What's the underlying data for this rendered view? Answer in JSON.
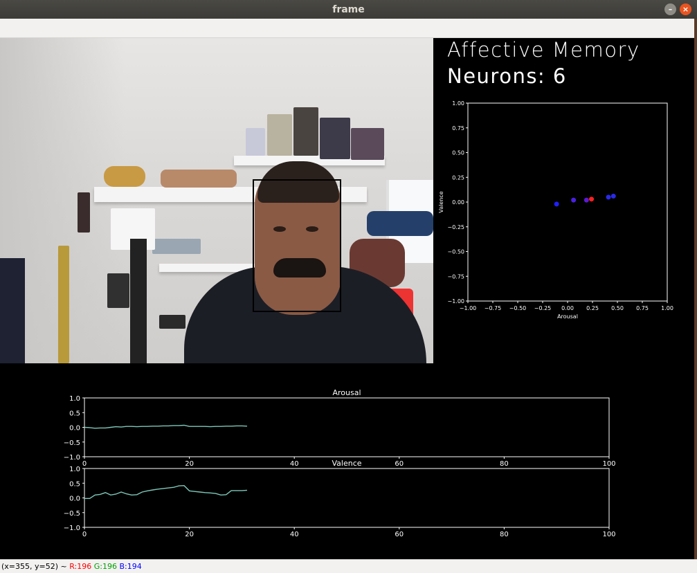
{
  "window": {
    "title": "frame"
  },
  "memory": {
    "title": "Affective Memory",
    "neurons_label": "Neurons:",
    "neurons_count": "6"
  },
  "scatter": {
    "xlabel": "Arousal",
    "ylabel": "Valence",
    "xticks": [
      "−1.00",
      "−0.75",
      "−0.50",
      "−0.25",
      "0.00",
      "0.25",
      "0.50",
      "0.75",
      "1.00"
    ],
    "yticks": [
      "1.00",
      "0.75",
      "0.50",
      "0.25",
      "0.00",
      "−0.25",
      "−0.50",
      "−0.75",
      "−1.00"
    ]
  },
  "arousal_plot": {
    "title": "Arousal",
    "xticks": [
      "0",
      "20",
      "40",
      "60",
      "80",
      "100"
    ],
    "yticks": [
      "1.0",
      "0.5",
      "0.0",
      "−0.5",
      "−1.0"
    ]
  },
  "valence_plot": {
    "title": "Valence",
    "xticks": [
      "0",
      "20",
      "40",
      "60",
      "80",
      "100"
    ],
    "yticks": [
      "1.0",
      "0.5",
      "0.0",
      "−0.5",
      "−1.0"
    ]
  },
  "status": {
    "coords": "(x=355, y=52) ~",
    "r": "R:196",
    "g": "G:196",
    "b": "B:194"
  },
  "chart_data": [
    {
      "type": "scatter",
      "xlabel": "Arousal",
      "ylabel": "Valence",
      "xlim": [
        -1,
        1
      ],
      "ylim": [
        -1,
        1
      ],
      "points": [
        {
          "x": -0.11,
          "y": -0.02,
          "color": "#2020ff"
        },
        {
          "x": 0.06,
          "y": 0.02,
          "color": "#4a20e0"
        },
        {
          "x": 0.19,
          "y": 0.02,
          "color": "#5a1ad0"
        },
        {
          "x": 0.24,
          "y": 0.03,
          "color": "#ff2020"
        },
        {
          "x": 0.41,
          "y": 0.05,
          "color": "#2a2ae8"
        },
        {
          "x": 0.46,
          "y": 0.06,
          "color": "#2a2ae8"
        }
      ]
    },
    {
      "type": "line",
      "title": "Arousal",
      "xlim": [
        0,
        100
      ],
      "ylim": [
        -1,
        1
      ],
      "color": "#7ec8b8",
      "x": [
        0,
        1,
        2,
        3,
        4,
        5,
        6,
        7,
        8,
        9,
        10,
        11,
        12,
        13,
        14,
        15,
        16,
        17,
        18,
        19,
        20,
        21,
        22,
        23,
        24,
        25,
        26,
        27,
        28,
        29,
        30,
        31
      ],
      "y": [
        0.0,
        -0.01,
        -0.03,
        -0.02,
        -0.02,
        0.0,
        0.02,
        0.01,
        0.03,
        0.03,
        0.02,
        0.03,
        0.03,
        0.04,
        0.04,
        0.05,
        0.05,
        0.06,
        0.06,
        0.07,
        0.03,
        0.03,
        0.03,
        0.03,
        0.02,
        0.03,
        0.03,
        0.04,
        0.04,
        0.05,
        0.05,
        0.04
      ]
    },
    {
      "type": "line",
      "title": "Valence",
      "xlim": [
        0,
        100
      ],
      "ylim": [
        -1,
        1
      ],
      "color": "#7ec8b8",
      "x": [
        0,
        1,
        2,
        3,
        4,
        5,
        6,
        7,
        8,
        9,
        10,
        11,
        12,
        13,
        14,
        15,
        16,
        17,
        18,
        19,
        20,
        21,
        22,
        23,
        24,
        25,
        26,
        27,
        28,
        29,
        30,
        31
      ],
      "y": [
        -0.02,
        -0.02,
        0.1,
        0.12,
        0.18,
        0.1,
        0.13,
        0.2,
        0.14,
        0.1,
        0.11,
        0.2,
        0.24,
        0.27,
        0.3,
        0.32,
        0.34,
        0.36,
        0.41,
        0.42,
        0.24,
        0.22,
        0.2,
        0.18,
        0.17,
        0.15,
        0.1,
        0.11,
        0.25,
        0.25,
        0.25,
        0.26
      ]
    }
  ]
}
